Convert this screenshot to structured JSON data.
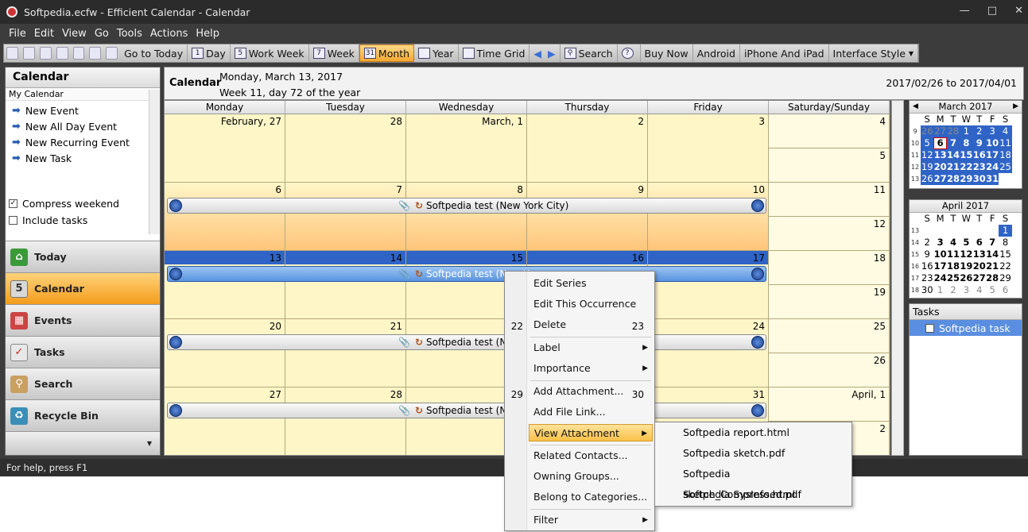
{
  "window": {
    "title": "Softpedia.ecfw - Efficient Calendar - Calendar"
  },
  "menu": [
    "File",
    "Edit",
    "View",
    "Go",
    "Tools",
    "Actions",
    "Help"
  ],
  "toolbar": {
    "goto_today": "Go to Today",
    "day": "Day",
    "work_week": "Work Week",
    "week": "Week",
    "month": "Month",
    "year": "Year",
    "time_grid": "Time Grid",
    "search": "Search",
    "buy_now": "Buy Now",
    "android": "Android",
    "iphone": "iPhone And iPad",
    "interface_style": "Interface Style",
    "day_icon": "1",
    "work_week_icon": "5",
    "week_icon": "7",
    "month_icon": "31"
  },
  "left": {
    "header": "Calendar",
    "sub": "My Calendar",
    "items": [
      "New Event",
      "New All Day Event",
      "New Recurring Event",
      "New Task"
    ],
    "compress_weekend": "Compress weekend",
    "include_tasks": "Include tasks",
    "nav": [
      "Today",
      "Calendar",
      "Events",
      "Tasks",
      "Search",
      "Recycle Bin"
    ]
  },
  "cal": {
    "title": "Calendar",
    "date": "Monday, March 13, 2017",
    "week": "Week 11, day 72 of the year",
    "range": "2017/02/26 to 2017/04/01",
    "days": [
      "Monday",
      "Tuesday",
      "Wednesday",
      "Thursday",
      "Friday",
      "Saturday/Sunday"
    ],
    "event": "Softpedia test (New York City)",
    "event_short": "Softpedia test (New Y"
  },
  "weeks": [
    {
      "days": [
        "February, 27",
        "28",
        "March, 1",
        "2",
        "3"
      ],
      "sat": "4",
      "sun": "5"
    },
    {
      "days": [
        "6",
        "7",
        "8",
        "9",
        "10"
      ],
      "sat": "11",
      "sun": "12"
    },
    {
      "days": [
        "13",
        "14",
        "15",
        "16",
        "17"
      ],
      "sat": "18",
      "sun": "19"
    },
    {
      "days": [
        "20",
        "21",
        "22",
        "23",
        "24"
      ],
      "sat": "25",
      "sun": "26"
    },
    {
      "days": [
        "27",
        "28",
        "29",
        "30",
        "31"
      ],
      "sat": "April, 1",
      "sun": "2"
    }
  ],
  "mini_march": {
    "title": "March 2017",
    "dow": [
      "S",
      "M",
      "T",
      "W",
      "T",
      "F",
      "S"
    ]
  },
  "mini_april": {
    "title": "April 2017"
  },
  "tasks": {
    "header": "Tasks",
    "item": "Softpedia task"
  },
  "status": "For help, press F1",
  "context_menu": [
    "Edit Series",
    "Edit This Occurrence",
    "Delete",
    "Label",
    "Importance",
    "Add Attachment...",
    "Add File Link...",
    "View Attachment",
    "Related Contacts...",
    "Owning Groups...",
    "Belong to Categories...",
    "Filter"
  ],
  "attachments": [
    "Softpedia report.html",
    "Softpedia sketch.pdf",
    "Softpedia sketch_Compressed.pdf",
    "Softpedia SysInfo.html"
  ]
}
